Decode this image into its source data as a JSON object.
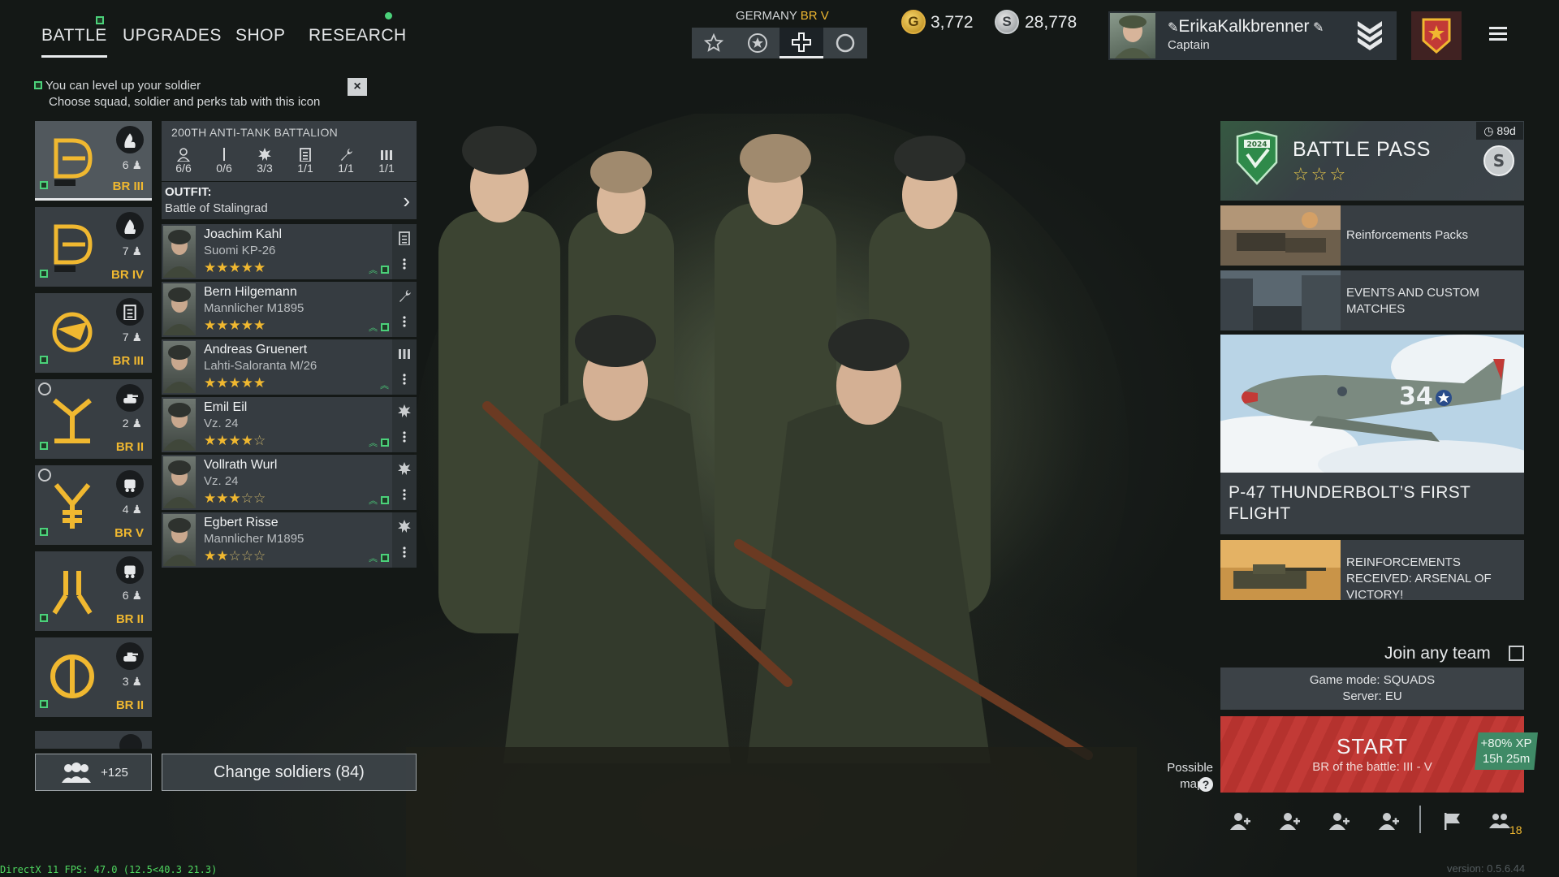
{
  "nav": {
    "tabs": [
      {
        "label": "BATTLE",
        "active": true,
        "badge": "level-up-square"
      },
      {
        "label": "UPGRADES"
      },
      {
        "label": "SHOP"
      },
      {
        "label": "RESEARCH",
        "badge": "green-dot"
      }
    ]
  },
  "hint": {
    "line1": "You can level up your soldier",
    "line2": "Choose squad, soldier and perks tab with this icon",
    "close_icon": "close-icon"
  },
  "nation": {
    "label": "GERMANY",
    "br": "BR V",
    "options": [
      "star-icon",
      "circle-star-icon",
      "balkenkreuz-icon",
      "roundel-icon"
    ],
    "selected_index": 2
  },
  "currency": {
    "gold": "3,772",
    "silver": "28,778"
  },
  "profile": {
    "name": "ErikaKalkbrenner",
    "rank": "Captain"
  },
  "squads": [
    {
      "count": "6",
      "br": "BR III",
      "type_icon": "flamethrower-icon",
      "active": true
    },
    {
      "count": "7",
      "br": "BR IV",
      "type_icon": "flame-icon"
    },
    {
      "count": "7",
      "br": "BR III",
      "type_icon": "list-icon"
    },
    {
      "count": "2",
      "br": "BR II",
      "type_icon": "tank-icon",
      "medal": true
    },
    {
      "count": "4",
      "br": "BR V",
      "type_icon": "vehicle-icon",
      "medal": true
    },
    {
      "count": "6",
      "br": "BR II",
      "type_icon": "vehicle-icon"
    },
    {
      "count": "3",
      "br": "BR II",
      "type_icon": "tank-icon"
    }
  ],
  "add_squad": {
    "label": "+125"
  },
  "roster": {
    "title": "200TH ANTI-TANK BATTALION",
    "slots": [
      {
        "value": "6/6",
        "icon": "soldier-icon"
      },
      {
        "value": "0/6",
        "icon": "rifle-icon"
      },
      {
        "value": "3/3",
        "icon": "explosion-icon"
      },
      {
        "value": "1/1",
        "icon": "list-icon"
      },
      {
        "value": "1/1",
        "icon": "wrench-icon"
      },
      {
        "value": "1/1",
        "icon": "ammo-icon"
      }
    ],
    "outfit_label": "OUTFIT:",
    "outfit_name": "Battle of Stalingrad",
    "soldiers": [
      {
        "name": "Joachim Kahl",
        "weapon": "Suomi KP-26",
        "stars": 5,
        "role_icon": "list-icon"
      },
      {
        "name": "Bern Hilgemann",
        "weapon": "Mannlicher M1895",
        "stars": 5,
        "role_icon": "wrench-icon"
      },
      {
        "name": "Andreas Gruenert",
        "weapon": "Lahti-Saloranta M/26",
        "stars": 5,
        "role_icon": "ammo-icon"
      },
      {
        "name": "Emil Eil",
        "weapon": "Vz. 24",
        "stars": 4,
        "role_icon": "explosion-icon"
      },
      {
        "name": "Vollrath Wurl",
        "weapon": "Vz. 24",
        "stars": 3,
        "role_icon": "explosion-icon"
      },
      {
        "name": "Egbert Risse",
        "weapon": "Mannlicher M1895",
        "stars": 2,
        "role_icon": "explosion-icon"
      }
    ],
    "change_label": "Change soldiers (84)"
  },
  "battle_pass": {
    "title": "BATTLE PASS",
    "timer": "89d",
    "badge_year": "2024",
    "stars_total": 3
  },
  "promos": {
    "reinforcements": "Reinforcements Packs",
    "events": "EVENTS AND CUSTOM MATCHES",
    "p47_title": "P-47 THUNDERBOLT’S FIRST FLIGHT",
    "p47_plane_number": "34",
    "arsenal": "REINFORCEMENTS RECEIVED: ARSENAL OF VICTORY!"
  },
  "matchmaking": {
    "join_any_team": "Join any team",
    "join_checked": false,
    "game_mode": "Game mode: SQUADS",
    "server": "Server: EU",
    "start_label": "START",
    "start_sub": "BR of the battle: III - V",
    "xp_bonus": "+80% XP",
    "xp_time": "15h 25m",
    "maps_label": "Possible maps:",
    "maps_help": "?",
    "party_count": "18"
  },
  "footer": {
    "fps": "DirectX 11 FPS: 47.0 (12.5<40.3 21.3)",
    "version": "version: 0.5.6.44"
  },
  "colors": {
    "br_gold": "#f0b830",
    "level_green": "#4bd17a",
    "start_red": "#c23a36",
    "xp_green": "#3f8a66"
  }
}
